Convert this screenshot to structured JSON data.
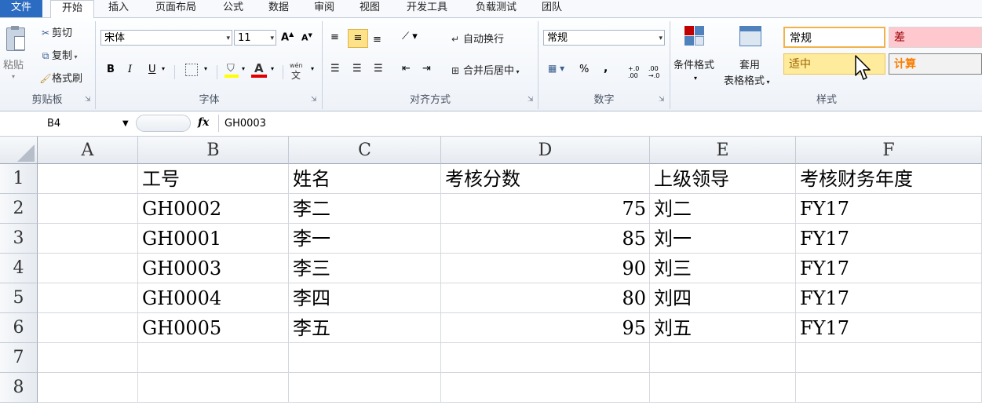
{
  "menu": {
    "file": "文件",
    "tabs": [
      "开始",
      "插入",
      "页面布局",
      "公式",
      "数据",
      "审阅",
      "视图",
      "开发工具",
      "负载测试",
      "团队"
    ]
  },
  "clipboard": {
    "paste": "粘贴",
    "cut": "剪切",
    "copy": "复制",
    "format_painter": "格式刷",
    "label": "剪贴板"
  },
  "font": {
    "name": "宋体",
    "size": "11",
    "grow": "A",
    "shrink": "A",
    "bold": "B",
    "italic": "I",
    "underline": "U",
    "font_color_letter": "A",
    "phonetic": "wén",
    "label": "字体"
  },
  "alignment": {
    "wrap_text": "自动换行",
    "merge_center": "合并后居中",
    "label": "对齐方式"
  },
  "number": {
    "format": "常规",
    "percent": "%",
    "comma": ",",
    "inc_decimal": "+.0 .00",
    "dec_decimal": ".00 →.0",
    "label": "数字"
  },
  "styles": {
    "conditional": "条件格式",
    "table_format_1": "套用",
    "table_format_2": "表格格式",
    "cells": [
      {
        "text": "常规",
        "bg": "#ffffff",
        "fg": "#000000"
      },
      {
        "text": "差",
        "bg": "#ffc7ce",
        "fg": "#9c0006"
      },
      {
        "text": "适中",
        "bg": "#ffeb9c",
        "fg": "#9c6500"
      },
      {
        "text": "计算",
        "bg": "#f2f2f2",
        "fg": "#fa7d00"
      }
    ],
    "label": "样式"
  },
  "formula_bar": {
    "name_box": "B4",
    "fx": "fx",
    "content": "GH0003"
  },
  "sheet": {
    "columns": [
      "A",
      "B",
      "C",
      "D",
      "E",
      "F"
    ],
    "rows": [
      "1",
      "2",
      "3",
      "4",
      "5",
      "6",
      "7",
      "8"
    ],
    "headers": [
      "工号",
      "姓名",
      "考核分数",
      "上级领导",
      "考核财务年度"
    ],
    "data": [
      [
        "GH0002",
        "李二",
        "75",
        "刘二",
        "FY17"
      ],
      [
        "GH0001",
        "李一",
        "85",
        "刘一",
        "FY17"
      ],
      [
        "GH0003",
        "李三",
        "90",
        "刘三",
        "FY17"
      ],
      [
        "GH0004",
        "李四",
        "80",
        "刘四",
        "FY17"
      ],
      [
        "GH0005",
        "李五",
        "95",
        "刘五",
        "FY17"
      ]
    ]
  }
}
